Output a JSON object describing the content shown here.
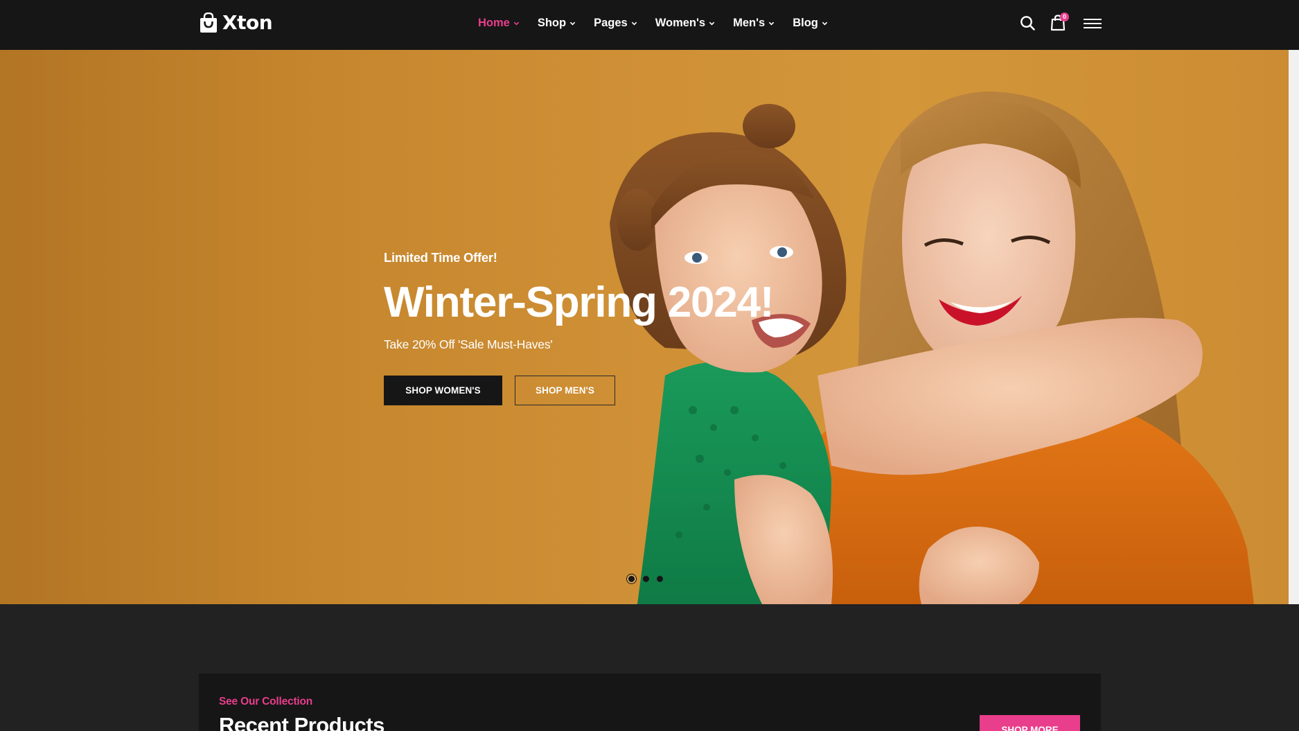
{
  "brand": {
    "name": "Xton",
    "logo_icon": "shopping-bag-icon"
  },
  "nav": {
    "items": [
      {
        "label": "Home",
        "active": true
      },
      {
        "label": "Shop",
        "active": false
      },
      {
        "label": "Pages",
        "active": false
      },
      {
        "label": "Women's",
        "active": false
      },
      {
        "label": "Men's",
        "active": false
      },
      {
        "label": "Blog",
        "active": false
      }
    ]
  },
  "header_icons": {
    "search": "search-icon",
    "cart": "shopping-bag-icon",
    "cart_count": "0",
    "menu": "hamburger-icon"
  },
  "hero": {
    "kicker": "Limited Time Offer!",
    "title": "Winter-Spring 2024!",
    "subtitle": "Take 20% Off 'Sale Must-Haves'",
    "buttons": {
      "primary": "SHOP WOMEN'S",
      "secondary": "SHOP MEN'S"
    },
    "slides": 3,
    "active_slide": 1
  },
  "products": {
    "kicker": "See Our Collection",
    "title": "Recent Products",
    "shop_more": "SHOP MORE"
  },
  "colors": {
    "accent": "#e83e8c",
    "header_bg": "#161616",
    "page_bg": "#222222",
    "hero_bg": "#cf9036"
  }
}
